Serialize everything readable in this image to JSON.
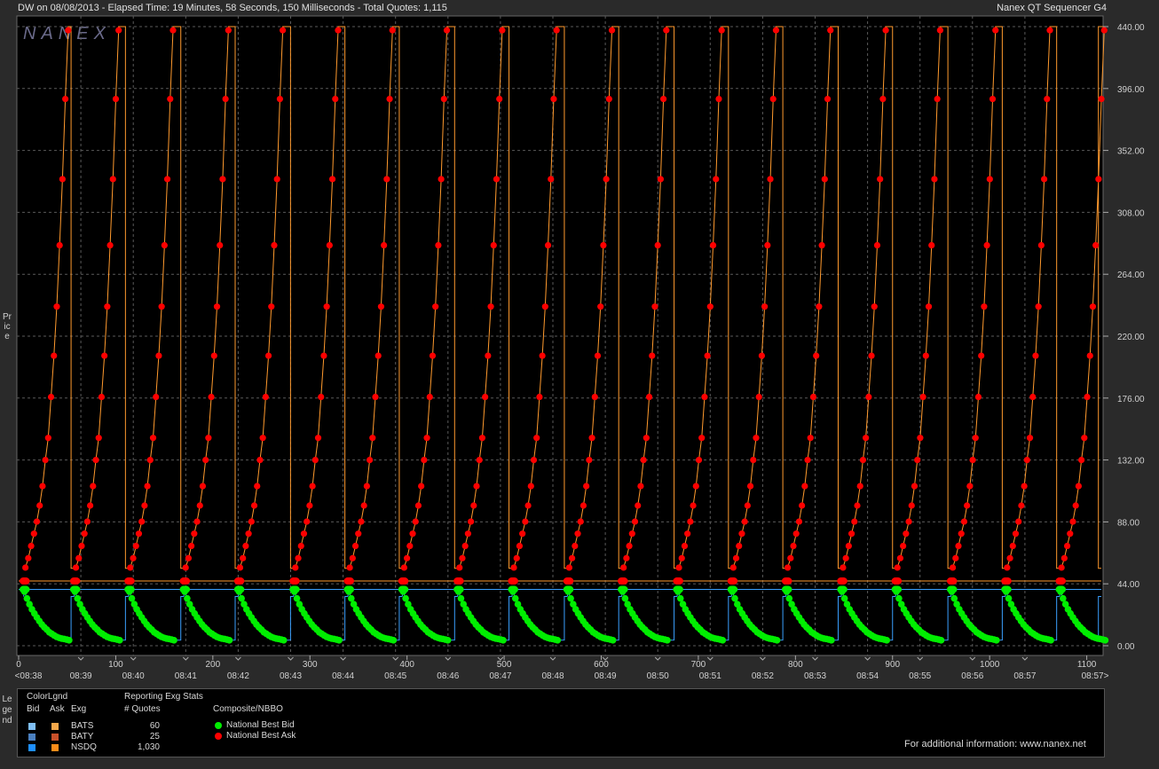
{
  "header": {
    "left": "DW on 08/08/2013  -  Elapsed Time: 19 Minutes, 58 Seconds, 150 Milliseconds  -  Total Quotes: 1,115",
    "right": "Nanex QT Sequencer G4"
  },
  "watermark": "NANEX",
  "side_labels": {
    "price": "Price",
    "legend": "Legend"
  },
  "chart_data": {
    "type": "scatter",
    "yaxis": {
      "ticks": [
        "440.00",
        "396.00",
        "352.00",
        "308.00",
        "264.00",
        "220.00",
        "176.00",
        "132.00",
        "88.00",
        "44.00",
        "0.00"
      ],
      "ylim": [
        0,
        440
      ],
      "grid": true
    },
    "xaxis_top": {
      "ticks": [
        "0",
        "100",
        "200",
        "300",
        "400",
        "500",
        "600",
        "700",
        "800",
        "900",
        "1000",
        "1100"
      ],
      "xlim": [
        0,
        1115
      ]
    },
    "xaxis_time": {
      "ticks": [
        "<08:38",
        "08:39",
        "08:40",
        "08:41",
        "08:42",
        "08:43",
        "08:44",
        "08:45",
        "08:46",
        "08:47",
        "08:48",
        "08:49",
        "08:50",
        "08:51",
        "08:52",
        "08:53",
        "08:54",
        "08:55",
        "08:56",
        "08:57",
        "08:57>"
      ]
    },
    "cycle_start_x": [
      5,
      57,
      113,
      170,
      226,
      283,
      339,
      395,
      452,
      508,
      565,
      621,
      678,
      734,
      790,
      847,
      903,
      960,
      1016,
      1072
    ],
    "ask_ramp_values": [
      55.5,
      62.2,
      70.9,
      79.6,
      88.2,
      99.6,
      113.4,
      132.0,
      147.7,
      176.8,
      206.1,
      241.0,
      284.6,
      331.6,
      388.6,
      437.4
    ],
    "bid_decay_values": [
      38.5,
      33.6,
      29.5,
      25.9,
      22.9,
      20.1,
      17.5,
      15.1,
      13.1,
      11.5,
      9.6,
      8.5,
      7.3,
      6.3,
      5.6,
      5.1,
      4.8,
      4.4,
      3.9
    ],
    "ask_hold_value": 46,
    "bid_hold_value": 40,
    "step_line_values": {
      "ask_high": 440,
      "ask_low": 55,
      "bid_high": 35,
      "bid_low": 4
    },
    "colors": {
      "ask_dots": "#ff0000",
      "bid_dots": "#00ee00",
      "ask_line": "#ff9a2e",
      "bid_line": "#3aa0ff",
      "grid": "#5a5a5a",
      "plot_bg": "#000000"
    }
  },
  "legend": {
    "color_legend_title": "ColorLgnd",
    "col_bid": "Bid",
    "col_ask": "Ask",
    "col_exg": "Exg",
    "stats_title": "Reporting Exg Stats",
    "stats_col": "# Quotes",
    "composite_title": "Composite/NBBO",
    "exchanges": [
      {
        "name": "BATS",
        "quotes": "60",
        "bid_color": "#7fbff5",
        "ask_color": "#f5a84a"
      },
      {
        "name": "BATY",
        "quotes": "25",
        "bid_color": "#4a7fbf",
        "ask_color": "#c8502a"
      },
      {
        "name": "NSDQ",
        "quotes": "1,030",
        "bid_color": "#1e8fff",
        "ask_color": "#ff8c1a"
      }
    ],
    "composite": [
      {
        "label": "National Best Bid",
        "color": "#00ee00"
      },
      {
        "label": "National Best Ask",
        "color": "#ff0000"
      }
    ],
    "footer": "For additional information: www.nanex.net"
  }
}
